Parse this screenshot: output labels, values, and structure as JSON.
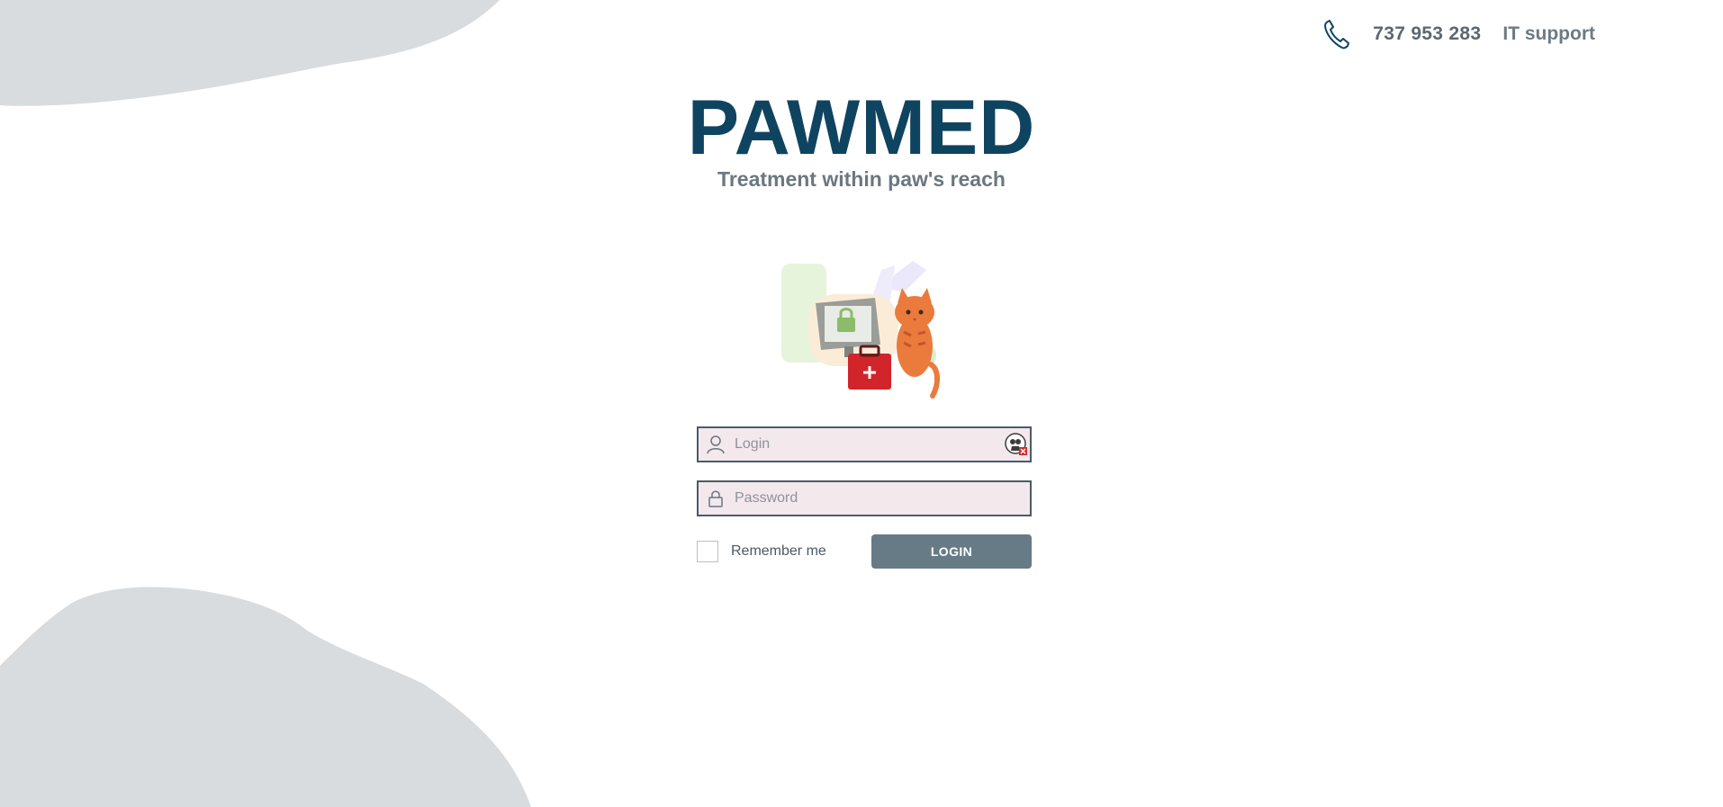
{
  "header": {
    "phone_icon": "phone-icon",
    "phone_number": "737 953 283",
    "support_label": "IT support"
  },
  "brand": {
    "title": "PAWMED",
    "tagline": "Treatment within paw's reach"
  },
  "illustration": {
    "icon": "cat-with-computer-and-medkit-illustration"
  },
  "form": {
    "login_placeholder": "Login",
    "login_value": "",
    "password_placeholder": "Password",
    "password_value": "",
    "remember_label": "Remember me",
    "remember_checked": false,
    "login_button": "LOGIN"
  },
  "colors": {
    "brand": "#0f4460",
    "blob": "#d8dcdf",
    "field_bg": "#f3e8ec",
    "button_bg": "#677b87"
  }
}
